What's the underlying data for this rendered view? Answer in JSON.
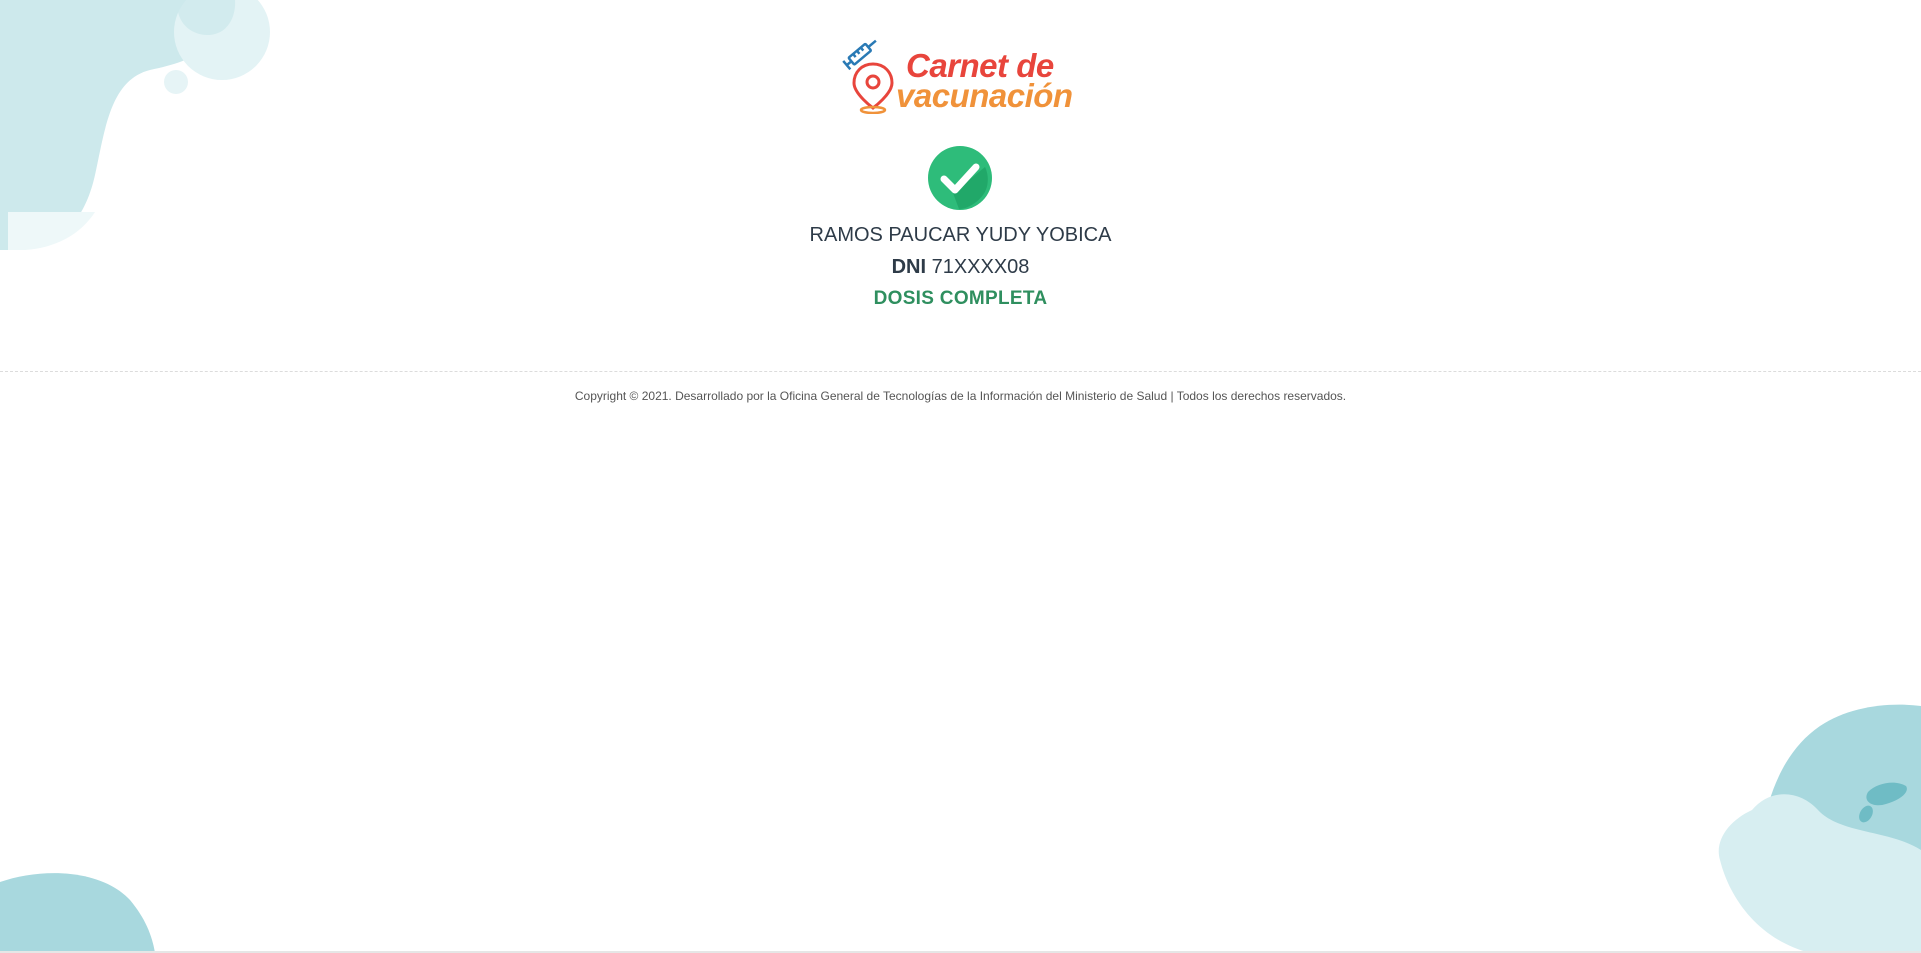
{
  "logo": {
    "line1": "Carnet de",
    "line2": "vacunación",
    "icon": "syringe-location-pin-icon",
    "colors": {
      "primary": "#e8453c",
      "secondary": "#f0923a",
      "syringe": "#2a7ab5"
    }
  },
  "status_icon": "check-circle-icon",
  "person": {
    "name": "RAMOS PAUCAR YUDY YOBICA",
    "dni_label": "DNI",
    "dni_value": "71XXXX08"
  },
  "vaccination_status": "DOSIS COMPLETA",
  "footer": {
    "copyright": "Copyright © 2021. Desarrollado por la Oficina General de Tecnologías de la Información del Ministerio de Salud | Todos los derechos reservados."
  },
  "colors": {
    "status_green": "#2f8f5f",
    "check_green": "#2ebc7a",
    "text_dark": "#2e3b48",
    "blob_teal": "#a8d8de"
  }
}
